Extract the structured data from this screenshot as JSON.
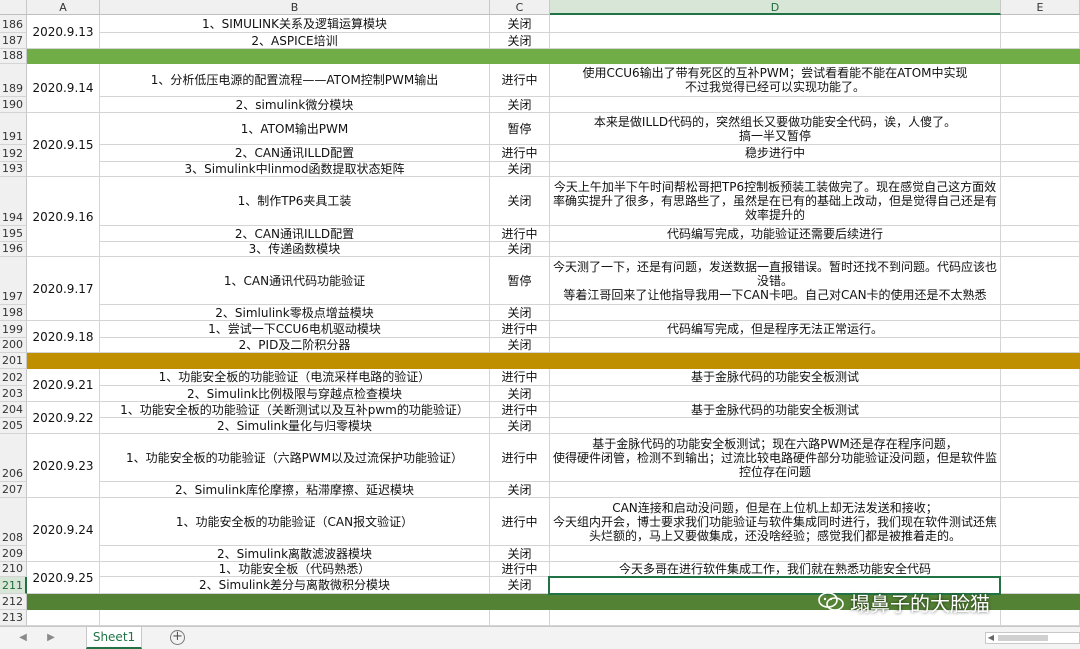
{
  "columns": [
    "A",
    "B",
    "C",
    "D",
    "E"
  ],
  "selected_column": "D",
  "selected_row": "211",
  "rows": [
    {
      "n": "186"
    },
    {
      "n": "187"
    },
    {
      "n": "188"
    },
    {
      "n": "189"
    },
    {
      "n": "190"
    },
    {
      "n": "191"
    },
    {
      "n": "192"
    },
    {
      "n": "193"
    },
    {
      "n": "194"
    },
    {
      "n": "195"
    },
    {
      "n": "196"
    },
    {
      "n": "197"
    },
    {
      "n": "198"
    },
    {
      "n": "199"
    },
    {
      "n": "200"
    },
    {
      "n": "201"
    },
    {
      "n": "202"
    },
    {
      "n": "203"
    },
    {
      "n": "204"
    },
    {
      "n": "205"
    },
    {
      "n": "206"
    },
    {
      "n": "207"
    },
    {
      "n": "208"
    },
    {
      "n": "209"
    },
    {
      "n": "210"
    },
    {
      "n": "211"
    },
    {
      "n": "212"
    },
    {
      "n": "213"
    }
  ],
  "dates": [
    "2020.9.13",
    "2020.9.14",
    "2020.9.15",
    "2020.9.16",
    "2020.9.17",
    "2020.9.18",
    "2020.9.21",
    "2020.9.22",
    "2020.9.23",
    "2020.9.24",
    "2020.9.25"
  ],
  "tasks": [
    "1、SIMULINK关系及逻辑运算模块",
    "2、ASPICE培训",
    "1、分析低压电源的配置流程——ATOM控制PWM输出",
    "2、simulink微分模块",
    "1、ATOM输出PWM",
    "2、CAN通讯ILLD配置",
    "3、Simulink中linmod函数提取状态矩阵",
    "1、制作TP6夹具工装",
    "2、CAN通讯ILLD配置",
    "3、传递函数模块",
    "1、CAN通讯代码功能验证",
    "2、Simlulink零极点增益模块",
    "1、尝试一下CCU6电机驱动模块",
    "2、PID及二阶积分器",
    "1、功能安全板的功能验证（电流采样电路的验证）",
    "2、Simulink比例极限与穿越点检查模块",
    "1、功能安全板的功能验证（关断测试以及互补pwm的功能验证）",
    "2、Simulink量化与归零模块",
    "1、功能安全板的功能验证（六路PWM以及过流保护功能验证）",
    "2、Simulink库伦摩擦，粘滞摩擦、延迟模块",
    "1、功能安全板的功能验证（CAN报文验证）",
    "2、Simulink离散滤波器模块",
    "1、功能安全板（代码熟悉）",
    "2、Simulink差分与离散微积分模块"
  ],
  "statuses": [
    "关闭",
    "关闭",
    "进行中",
    "关闭",
    "暂停",
    "进行中",
    "关闭",
    "关闭",
    "进行中",
    "关闭",
    "暂停",
    "关闭",
    "进行中",
    "关闭",
    "进行中",
    "关闭",
    "进行中",
    "关闭",
    "进行中",
    "关闭",
    "进行中",
    "关闭",
    "进行中",
    "关闭"
  ],
  "notes": [
    "使用CCU6输出了带有死区的互补PWM；尝试看看能不能在ATOM中实现\n不过我觉得已经可以实现功能了。",
    "本来是做ILLD代码的，突然组长又要做功能安全代码，诶，人傻了。\n搞一半又暂停",
    "稳步进行中",
    "今天上午加半下午时间帮松哥把TP6控制板预装工装做完了。现在感觉自己这方面效率确实提升了很多，有思路些了，虽然是在已有的基础上改动，但是觉得自己还是有效率提升的",
    "代码编写完成，功能验证还需要后续进行",
    "今天测了一下，还是有问题，发送数据一直报错误。暂时还找不到问题。代码应该也没错。\n等着江哥回来了让他指导我用一下CAN卡吧。自己对CAN卡的使用还是不太熟悉",
    "代码编写完成，但是程序无法正常运行。",
    "基于金脉代码的功能安全板测试",
    "基于金脉代码的功能安全板测试",
    "基于金脉代码的功能安全板测试；现在六路PWM还是存在程序问题，\n使得硬件闭管，检测不到输出；过流比较电路硬件部分功能验证没问题，但是软件监控位存在问题",
    "CAN连接和启动没问题，但是在上位机上却无法发送和接收；\n今天组内开会，博士要求我们功能验证与软件集成同时进行，我们现在软件测试还焦头烂额的，马上又要做集成，还没啥经验；感觉我们都是被推着走的。",
    "今天多哥在进行软件集成工作，我们就在熟悉功能安全代码"
  ],
  "band_colors": {
    "row188": "#70ad47",
    "row201": "#bf8f00",
    "row212": "#548235"
  },
  "sheet_tab": "Sheet1",
  "watermark": "塌鼻子的大脸猫"
}
